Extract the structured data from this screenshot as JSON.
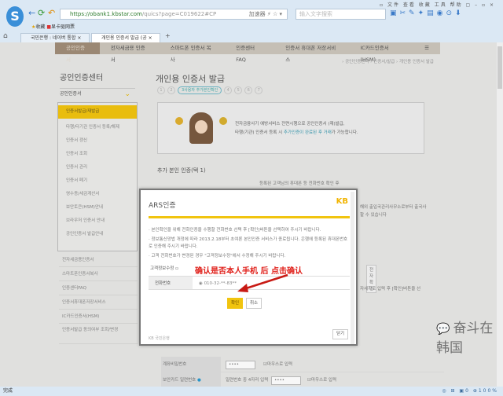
{
  "browser": {
    "url_host": "https://obank1.kbstar.com",
    "url_path": "/quics?page=C019622#CP",
    "url_extra": "加速器 ⚡ ☆ ▾",
    "search_placeholder": "输入文字搜索",
    "menus": "▫ 文件 查看 收藏 工具 帮助 ▢ – ▫ ×",
    "bookmarks": [
      "收藏",
      "显卡驱网票"
    ],
    "tabs": [
      "국민은행 : 네이버 통합",
      "개인용 인증서 발급 (공"
    ]
  },
  "topnav": [
    "공인인증서",
    "전자세금용 인증서",
    "스마트폰 인증서 복사",
    "인증센터FAQ",
    "인증서 휴대폰 저장서비스",
    "IC카드인증서(HSM)"
  ],
  "breadcrumb": "› 공인인증센터 › 인증서/발급 › 개인용 인증서 발급",
  "sidebar": {
    "title": "공인인증센터",
    "selector": "공인인증서",
    "submenu": [
      "인증서발급/재발급",
      "타행/타기관 인증서 등록/해제",
      "인증서 갱신",
      "인증서 조회",
      "인증서 관리",
      "인증서 폐기",
      "영수증/세금계산서",
      "보안토큰(HSM)안내",
      "브라우저 인증서 안내",
      "공인인증서 발급안내"
    ],
    "items": [
      "전자세금용인증서",
      "스마트폰인증서복사",
      "인증센터FAQ",
      "인증서휴대폰저장서비스",
      "IC카드인증서(HSM)",
      "인증서발급 동의여부 조회/변경"
    ]
  },
  "main": {
    "title": "개인용 인증서 발급",
    "steps": [
      "1",
      "2",
      "3사용자 추가본인확인",
      "4",
      "5",
      "6",
      "7"
    ],
    "info_line1": "전자금융사기 예방서비스 전면시행으로 공인인증서 (재)발급,",
    "info_line2_a": "타행(기관) 인증서 등록 시 ",
    "info_line2_hi": "추가인증이 완료된 후 거래",
    "info_line2_b": "가 가능합니다.",
    "section": "추가 본인 인증(택 1)",
    "row1": "등록된 고객님의 휴대폰 등 전화번호 확인 후",
    "row2": "해외 출입국관리사무소로부터 출국사",
    "row2b": "할 수 있습니다",
    "row3_btn": "전자확인",
    "row4": "자세히로 입력 후 [확인]버튼을 선"
  },
  "form": {
    "pw_label": "계좌비밀번호",
    "pw_value": "••••",
    "mouse1": "마우스로 입력",
    "card_label": "보안카드 일련번호",
    "card_hint": "일련번호 중 4자리 입력",
    "card_value": "••••",
    "mouse2": "마우스로 입력"
  },
  "modal": {
    "title": "ARS인증",
    "logo": "KB",
    "notes": [
      "· 본인확인을 위해 전화인증을 수행할 전화번호 선택 후 [확인]버튼을 선택하여 주시기 바랍니다.",
      "· 정보통신망법 개정에 따라 2013.2.18부터 초여론 본인인증 서비스가 종료됩니다. 은행에 등록된 휴대폰번호로 인증해 주시기 바랍니다.",
      "· 고객 전화번호가 변경된 경우 \"고객정보수정\"에서 수정해 주시기 바랍니다."
    ],
    "link": "고객정보수정 ▫",
    "phone_label": "전화번호",
    "phone_value": "010-32-**-83**",
    "ok": "확인",
    "cancel": "취소",
    "footer": "KB 국민은행",
    "close": "닫기"
  },
  "annotation": "确认是否本人手机 后 点击确认",
  "watermark": "奋斗在韩国",
  "status": {
    "left": "完成",
    "right": "◎ ⊞ ▣0 ⊕100%"
  },
  "colors": {
    "accent": "#f1c40f",
    "annotation": "#e0201a"
  }
}
